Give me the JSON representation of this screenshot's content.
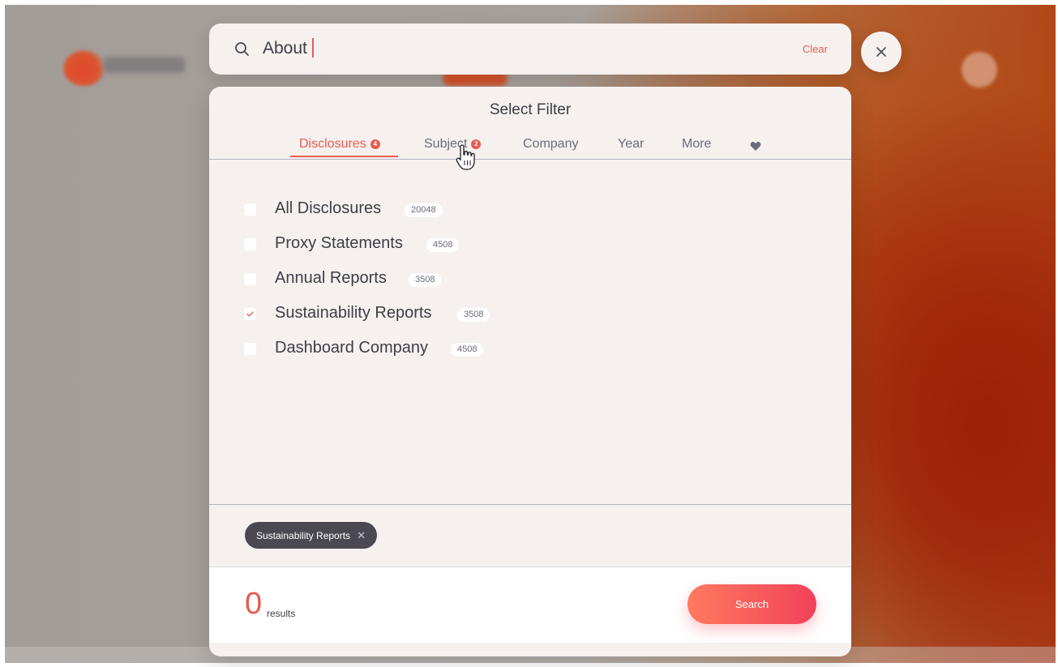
{
  "search": {
    "query": "About",
    "clear_label": "Clear"
  },
  "panel": {
    "title": "Select Filter",
    "tabs": [
      {
        "label": "Disclosures",
        "badge": "4",
        "active": true
      },
      {
        "label": "Subject",
        "badge": "2"
      },
      {
        "label": "Company"
      },
      {
        "label": "Year"
      },
      {
        "label": "More"
      }
    ],
    "favorites_icon": "heart-icon"
  },
  "options": [
    {
      "label": "All Disclosures",
      "count": "20048",
      "checked": false
    },
    {
      "label": "Proxy Statements",
      "count": "4508",
      "checked": false
    },
    {
      "label": "Annual Reports",
      "count": "3508",
      "checked": false
    },
    {
      "label": "Sustainability Reports",
      "count": "3508",
      "checked": true
    },
    {
      "label": "Dashboard Company",
      "count": "4508",
      "checked": false
    }
  ],
  "selected_chips": [
    {
      "label": "Sustainability Reports",
      "remove_icon": "close-icon"
    }
  ],
  "footer": {
    "result_count": "0",
    "result_label": "results",
    "search_label": "Search"
  },
  "colors": {
    "accent": "#e85a4f",
    "text": "#3d3d46",
    "muted": "#6b6c7c",
    "chip": "#4a4952"
  }
}
